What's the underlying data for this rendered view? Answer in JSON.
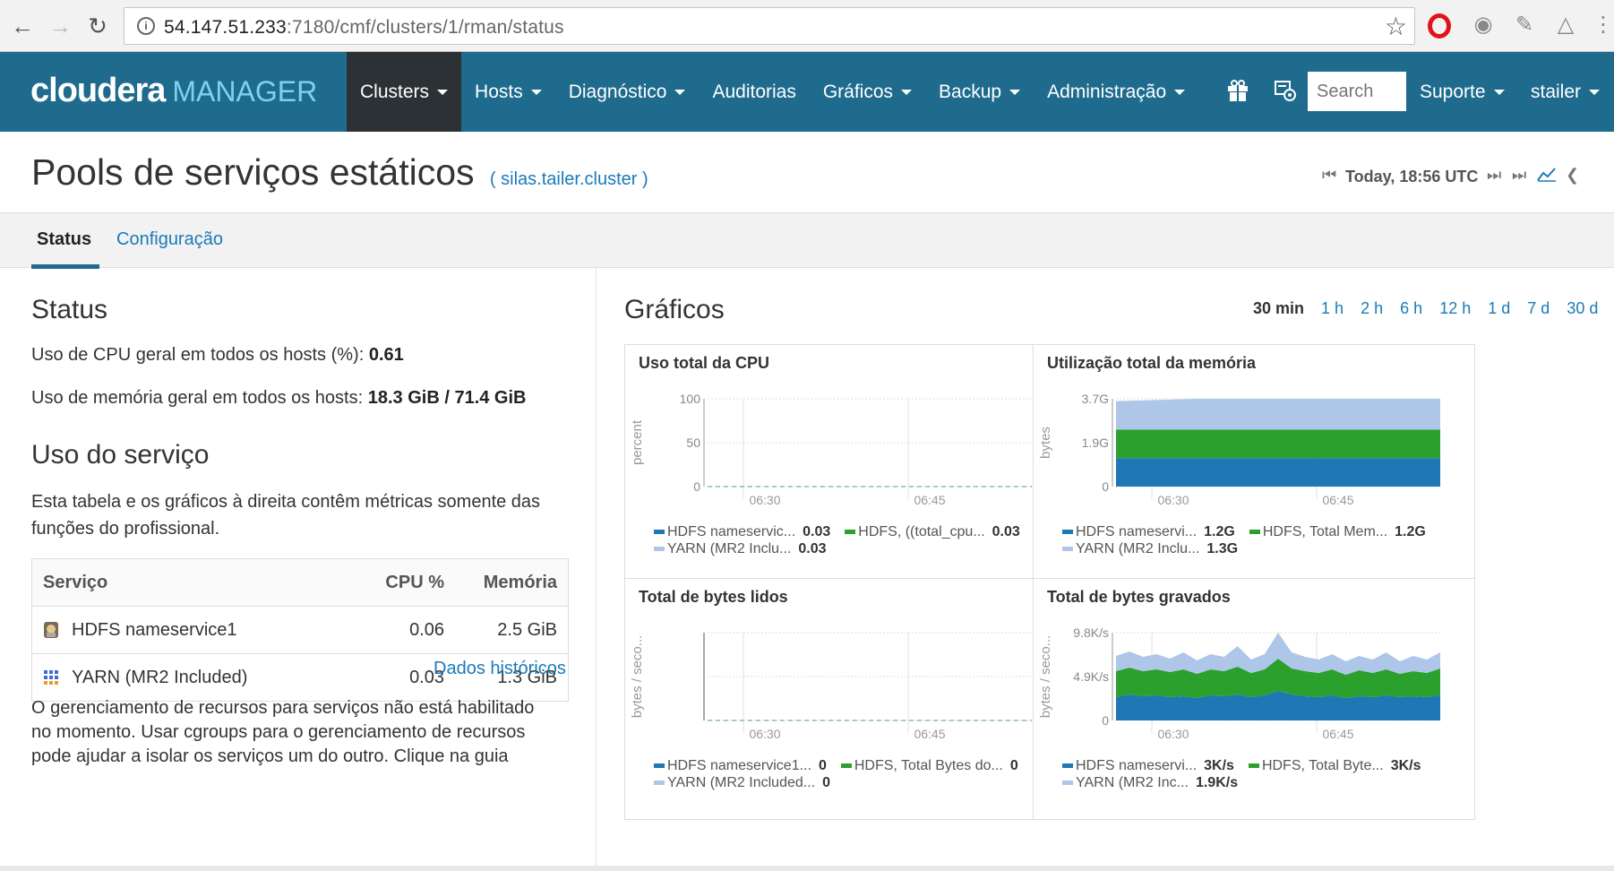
{
  "browser": {
    "url_host": "54.147.51.233",
    "url_rest": ":7180/cmf/clusters/1/rman/status"
  },
  "header": {
    "logo_main": "cloudera",
    "logo_sub": "MANAGER",
    "menu": [
      {
        "label": "Clusters",
        "caret": true
      },
      {
        "label": "Hosts",
        "caret": true
      },
      {
        "label": "Diagnóstico",
        "caret": true
      },
      {
        "label": "Auditorias",
        "caret": false
      },
      {
        "label": "Gráficos",
        "caret": true
      },
      {
        "label": "Backup",
        "caret": true
      },
      {
        "label": "Administração",
        "caret": true
      }
    ],
    "search_placeholder": "Search",
    "support_label": "Suporte",
    "user_label": "stailer"
  },
  "page": {
    "title": "Pools de serviços estáticos",
    "cluster_link": "( silas.tailer.cluster )",
    "time_label": "Today, 18:56 UTC"
  },
  "tabs": [
    {
      "label": "Status",
      "active": true
    },
    {
      "label": "Configuração",
      "active": false
    }
  ],
  "status": {
    "heading": "Status",
    "cpu_text": "Uso de CPU geral em todos os hosts (%): ",
    "cpu_value": "0.61",
    "mem_text": "Uso de memória geral em todos os hosts: ",
    "mem_value": "18.3 GiB",
    "mem_sep": " / ",
    "mem_total": "71.4 GiB"
  },
  "usage": {
    "heading": "Uso do serviço",
    "desc_line1": "Esta tabela e os gráficos à direita contêm métricas somente das",
    "desc_line2": "funções do profissional.",
    "columns": [
      "Serviço",
      "CPU %",
      "Memória"
    ],
    "rows": [
      {
        "name": "HDFS nameservice1",
        "cpu": "0.06",
        "mem": "2.5 GiB",
        "icon": "hdfs-icon"
      },
      {
        "name": "YARN (MR2 Included)",
        "cpu": "0.03",
        "mem": "1.3 GiB",
        "icon": "yarn-icon"
      }
    ],
    "history_link": "Dados históricos",
    "footer_line1": "O gerenciamento de recursos para serviços não está habilitado",
    "footer_line2": "no momento. Usar cgroups para o gerenciamento de recursos",
    "footer_line3": "pode ajudar a isolar os serviços um do outro. Clique na guia"
  },
  "charts_panel": {
    "heading": "Gráficos",
    "ranges": [
      "30 min",
      "1 h",
      "2 h",
      "6 h",
      "12 h",
      "1 d",
      "7 d",
      "30 d"
    ],
    "active_range": "30 min"
  },
  "colors": {
    "hdfs_ns": "#1f77b4",
    "hdfs": "#2ca02c",
    "yarn": "#aec7e8",
    "header_bg": "#1f6b8e",
    "link": "#1a7ab8"
  },
  "chart_data": [
    {
      "type": "line",
      "title": "Uso total da CPU",
      "ylabel": "percent",
      "ylim": [
        0,
        100
      ],
      "yticks": [
        "100",
        "50",
        "0"
      ],
      "xticks": [
        "06:30",
        "06:45"
      ],
      "series": [
        {
          "name": "HDFS nameservic...",
          "value_label": "0.03",
          "values": [
            0.03,
            0.03,
            0.03,
            0.03,
            0.03
          ]
        },
        {
          "name": "HDFS, ((total_cpu...",
          "value_label": "0.03",
          "values": [
            0.03,
            0.03,
            0.03,
            0.03,
            0.03
          ]
        },
        {
          "name": "YARN (MR2 Inclu...",
          "value_label": "0.03",
          "values": [
            0.03,
            0.03,
            0.03,
            0.03,
            0.03
          ]
        }
      ]
    },
    {
      "type": "area",
      "title": "Utilização total da memória",
      "ylabel": "bytes",
      "yticks": [
        "3.7G",
        "1.9G",
        "0"
      ],
      "xticks": [
        "06:30",
        "06:45"
      ],
      "series": [
        {
          "name": "HDFS nameservi...",
          "value_label": "1.2G",
          "values": [
            1.2,
            1.2,
            1.2,
            1.2,
            1.2
          ]
        },
        {
          "name": "HDFS, Total Mem...",
          "value_label": "1.2G",
          "values": [
            1.2,
            1.2,
            1.2,
            1.2,
            1.2
          ]
        },
        {
          "name": "YARN (MR2 Inclu...",
          "value_label": "1.3G",
          "values": [
            1.2,
            1.3,
            1.3,
            1.3,
            1.3
          ]
        }
      ]
    },
    {
      "type": "line",
      "title": "Total de bytes lidos",
      "ylabel": "bytes / seco...",
      "yticks": [],
      "xticks": [
        "06:30",
        "06:45"
      ],
      "series": [
        {
          "name": "HDFS nameservice1...",
          "value_label": "0",
          "values": [
            0,
            0,
            0,
            0,
            0
          ]
        },
        {
          "name": "HDFS, Total Bytes do...",
          "value_label": "0",
          "values": [
            0,
            0,
            0,
            0,
            0
          ]
        },
        {
          "name": "YARN (MR2 Included...",
          "value_label": "0",
          "values": [
            0,
            0,
            0,
            0,
            0
          ]
        }
      ]
    },
    {
      "type": "area",
      "title": "Total de bytes gravados",
      "ylabel": "bytes / seco...",
      "yticks": [
        "9.8K/s",
        "4.9K/s",
        "0"
      ],
      "xticks": [
        "06:30",
        "06:45"
      ],
      "series": [
        {
          "name": "HDFS nameservi...",
          "value_label": "3K/s",
          "values": [
            2.6,
            2.9,
            2.7,
            2.8,
            2.6,
            2.7,
            2.5,
            2.8,
            2.7,
            2.9,
            2.6,
            2.8,
            3.3,
            2.9,
            2.7,
            2.6,
            2.8,
            2.5,
            2.7,
            2.6,
            2.8,
            2.6,
            2.7,
            2.6,
            2.8
          ]
        },
        {
          "name": "HDFS, Total Byte...",
          "value_label": "3K/s",
          "values": [
            2.9,
            3.0,
            2.8,
            2.9,
            2.8,
            3.0,
            2.7,
            2.9,
            2.8,
            3.1,
            2.7,
            2.9,
            3.6,
            2.9,
            2.8,
            2.7,
            2.9,
            2.6,
            2.9,
            2.7,
            2.9,
            2.6,
            2.8,
            2.7,
            3.0
          ]
        },
        {
          "name": "YARN (MR2 Inc...",
          "value_label": "1.9K/s",
          "values": [
            1.7,
            1.8,
            1.6,
            1.7,
            1.5,
            1.9,
            1.5,
            1.7,
            1.6,
            2.3,
            1.5,
            1.7,
            2.9,
            1.8,
            1.6,
            1.5,
            1.7,
            1.5,
            1.6,
            1.5,
            1.9,
            1.4,
            1.7,
            1.5,
            1.8
          ]
        }
      ]
    }
  ]
}
